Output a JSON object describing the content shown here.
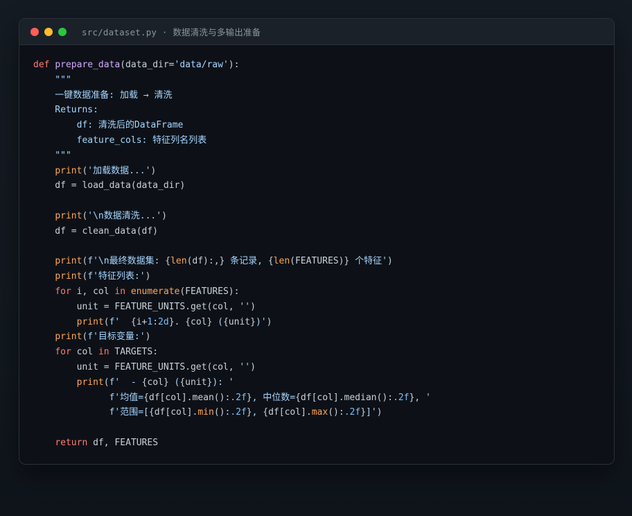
{
  "window": {
    "title": "src/dataset.py · 数据清洗与多输出准备",
    "controls": [
      {
        "name": "close",
        "color": "#ff5f57"
      },
      {
        "name": "minimize",
        "color": "#febc2e"
      },
      {
        "name": "maximize",
        "color": "#28c840"
      }
    ]
  },
  "code": {
    "lines": [
      [
        {
          "t": "def ",
          "c": "kw"
        },
        {
          "t": "prepare_data",
          "c": "fn"
        },
        {
          "t": "(data_dir=",
          "c": "var"
        },
        {
          "t": "'data/raw'",
          "c": "str"
        },
        {
          "t": "):",
          "c": "var"
        }
      ],
      [
        {
          "t": "    \"\"\"",
          "c": "doc"
        }
      ],
      [
        {
          "t": "    一键数据准备: 加载 → 清洗",
          "c": "doc"
        }
      ],
      [
        {
          "t": "    Returns:",
          "c": "doc"
        }
      ],
      [
        {
          "t": "        df: 清洗后的DataFrame",
          "c": "doc"
        }
      ],
      [
        {
          "t": "        feature_cols: 特征列名列表",
          "c": "doc"
        }
      ],
      [
        {
          "t": "    \"\"\"",
          "c": "doc"
        }
      ],
      [
        {
          "t": "    ",
          "c": "var"
        },
        {
          "t": "print",
          "c": "bi"
        },
        {
          "t": "(",
          "c": "var"
        },
        {
          "t": "'加载数据...'",
          "c": "str"
        },
        {
          "t": ")",
          "c": "var"
        }
      ],
      [
        {
          "t": "    df = load_data(data_dir)",
          "c": "var"
        }
      ],
      [],
      [
        {
          "t": "    ",
          "c": "var"
        },
        {
          "t": "print",
          "c": "bi"
        },
        {
          "t": "(",
          "c": "var"
        },
        {
          "t": "'\\n数据清洗...'",
          "c": "str"
        },
        {
          "t": ")",
          "c": "var"
        }
      ],
      [
        {
          "t": "    df = clean_data(df)",
          "c": "var"
        }
      ],
      [],
      [
        {
          "t": "    ",
          "c": "var"
        },
        {
          "t": "print",
          "c": "bi"
        },
        {
          "t": "(",
          "c": "var"
        },
        {
          "t": "f'\\n最终数据集: ",
          "c": "str"
        },
        {
          "t": "{",
          "c": "var"
        },
        {
          "t": "len",
          "c": "bi"
        },
        {
          "t": "(df):,}",
          "c": "var"
        },
        {
          "t": " 条记录, ",
          "c": "str"
        },
        {
          "t": "{",
          "c": "var"
        },
        {
          "t": "len",
          "c": "bi"
        },
        {
          "t": "(FEATURES)}",
          "c": "var"
        },
        {
          "t": " 个特征'",
          "c": "str"
        },
        {
          "t": ")",
          "c": "var"
        }
      ],
      [
        {
          "t": "    ",
          "c": "var"
        },
        {
          "t": "print",
          "c": "bi"
        },
        {
          "t": "(",
          "c": "var"
        },
        {
          "t": "f'特征列表:'",
          "c": "str"
        },
        {
          "t": ")",
          "c": "var"
        }
      ],
      [
        {
          "t": "    ",
          "c": "var"
        },
        {
          "t": "for",
          "c": "kw"
        },
        {
          "t": " i, col ",
          "c": "var"
        },
        {
          "t": "in",
          "c": "kw"
        },
        {
          "t": " ",
          "c": "var"
        },
        {
          "t": "enumerate",
          "c": "bi"
        },
        {
          "t": "(FEATURES):",
          "c": "var"
        }
      ],
      [
        {
          "t": "        unit = FEATURE_UNITS.get(col, ",
          "c": "var"
        },
        {
          "t": "''",
          "c": "str"
        },
        {
          "t": ")",
          "c": "var"
        }
      ],
      [
        {
          "t": "        ",
          "c": "var"
        },
        {
          "t": "print",
          "c": "bi"
        },
        {
          "t": "(",
          "c": "var"
        },
        {
          "t": "f'  ",
          "c": "str"
        },
        {
          "t": "{i+",
          "c": "var"
        },
        {
          "t": "1",
          "c": "num"
        },
        {
          "t": ":",
          "c": "var"
        },
        {
          "t": "2d",
          "c": "num"
        },
        {
          "t": "}",
          "c": "var"
        },
        {
          "t": ". ",
          "c": "str"
        },
        {
          "t": "{col}",
          "c": "var"
        },
        {
          "t": " (",
          "c": "str"
        },
        {
          "t": "{unit}",
          "c": "var"
        },
        {
          "t": ")'",
          "c": "str"
        },
        {
          "t": ")",
          "c": "var"
        }
      ],
      [
        {
          "t": "    ",
          "c": "var"
        },
        {
          "t": "print",
          "c": "bi"
        },
        {
          "t": "(",
          "c": "var"
        },
        {
          "t": "f'目标变量:'",
          "c": "str"
        },
        {
          "t": ")",
          "c": "var"
        }
      ],
      [
        {
          "t": "    ",
          "c": "var"
        },
        {
          "t": "for",
          "c": "kw"
        },
        {
          "t": " col ",
          "c": "var"
        },
        {
          "t": "in",
          "c": "kw"
        },
        {
          "t": " TARGETS:",
          "c": "var"
        }
      ],
      [
        {
          "t": "        unit = FEATURE_UNITS.get(col, ",
          "c": "var"
        },
        {
          "t": "''",
          "c": "str"
        },
        {
          "t": ")",
          "c": "var"
        }
      ],
      [
        {
          "t": "        ",
          "c": "var"
        },
        {
          "t": "print",
          "c": "bi"
        },
        {
          "t": "(",
          "c": "var"
        },
        {
          "t": "f'  - ",
          "c": "str"
        },
        {
          "t": "{col}",
          "c": "var"
        },
        {
          "t": " (",
          "c": "str"
        },
        {
          "t": "{unit}",
          "c": "var"
        },
        {
          "t": "): '",
          "c": "str"
        }
      ],
      [
        {
          "t": "              f'均值=",
          "c": "str"
        },
        {
          "t": "{df[col].mean():",
          "c": "var"
        },
        {
          "t": ".2f",
          "c": "num"
        },
        {
          "t": "}",
          "c": "var"
        },
        {
          "t": ", 中位数=",
          "c": "str"
        },
        {
          "t": "{df[col].median():",
          "c": "var"
        },
        {
          "t": ".2f",
          "c": "num"
        },
        {
          "t": "}",
          "c": "var"
        },
        {
          "t": ", '",
          "c": "str"
        }
      ],
      [
        {
          "t": "              f'范围=[",
          "c": "str"
        },
        {
          "t": "{df[col].",
          "c": "var"
        },
        {
          "t": "min",
          "c": "bi"
        },
        {
          "t": "():",
          "c": "var"
        },
        {
          "t": ".2f",
          "c": "num"
        },
        {
          "t": "}",
          "c": "var"
        },
        {
          "t": ", ",
          "c": "str"
        },
        {
          "t": "{df[col].",
          "c": "var"
        },
        {
          "t": "max",
          "c": "bi"
        },
        {
          "t": "():",
          "c": "var"
        },
        {
          "t": ".2f",
          "c": "num"
        },
        {
          "t": "}",
          "c": "var"
        },
        {
          "t": "]'",
          "c": "str"
        },
        {
          "t": ")",
          "c": "var"
        }
      ],
      [],
      [
        {
          "t": "    ",
          "c": "var"
        },
        {
          "t": "return",
          "c": "kw"
        },
        {
          "t": " df, FEATURES",
          "c": "var"
        }
      ]
    ]
  }
}
